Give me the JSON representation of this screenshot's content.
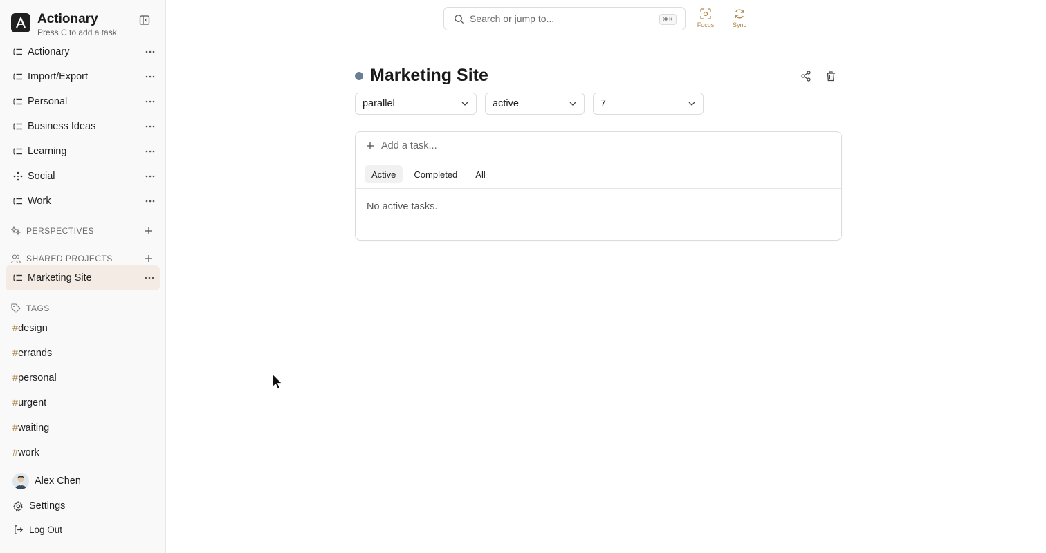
{
  "app": {
    "name": "Actionary",
    "subtitle": "Press C to add a task"
  },
  "sidebar": {
    "projects": [
      {
        "label": "Actionary",
        "icon": "list-icon"
      },
      {
        "label": "Import/Export",
        "icon": "list-icon"
      },
      {
        "label": "Personal",
        "icon": "list-icon"
      },
      {
        "label": "Business Ideas",
        "icon": "list-icon"
      },
      {
        "label": "Learning",
        "icon": "list-icon"
      },
      {
        "label": "Social",
        "icon": "network-icon"
      },
      {
        "label": "Work",
        "icon": "list-icon"
      }
    ],
    "perspectives_label": "PERSPECTIVES",
    "shared_label": "SHARED PROJECTS",
    "shared_projects": [
      {
        "label": "Marketing Site",
        "icon": "list-icon",
        "active": true
      }
    ],
    "tags_label": "TAGS",
    "tags": [
      {
        "hash": "#",
        "name": "design"
      },
      {
        "hash": "#",
        "name": "errands"
      },
      {
        "hash": "#",
        "name": "personal"
      },
      {
        "hash": "#",
        "name": "urgent"
      },
      {
        "hash": "#",
        "name": "waiting"
      },
      {
        "hash": "#",
        "name": "work"
      }
    ],
    "user_name": "Alex Chen",
    "settings_label": "Settings",
    "logout_label": "Log Out"
  },
  "topbar": {
    "search_placeholder": "Search or jump to...",
    "search_shortcut": "⌘K",
    "focus_label": "Focus",
    "sync_label": "Sync"
  },
  "project": {
    "title": "Marketing Site",
    "dot_color": "#6a7f95",
    "type_value": "parallel",
    "status_value": "active",
    "review_value": "7",
    "add_task_placeholder": "Add a task...",
    "tabs": [
      "Active",
      "Completed",
      "All"
    ],
    "selected_tab": "Active",
    "empty_message": "No active tasks."
  },
  "colors": {
    "accent": "#b0884a",
    "active_item_bg": "#f3ebe4"
  }
}
